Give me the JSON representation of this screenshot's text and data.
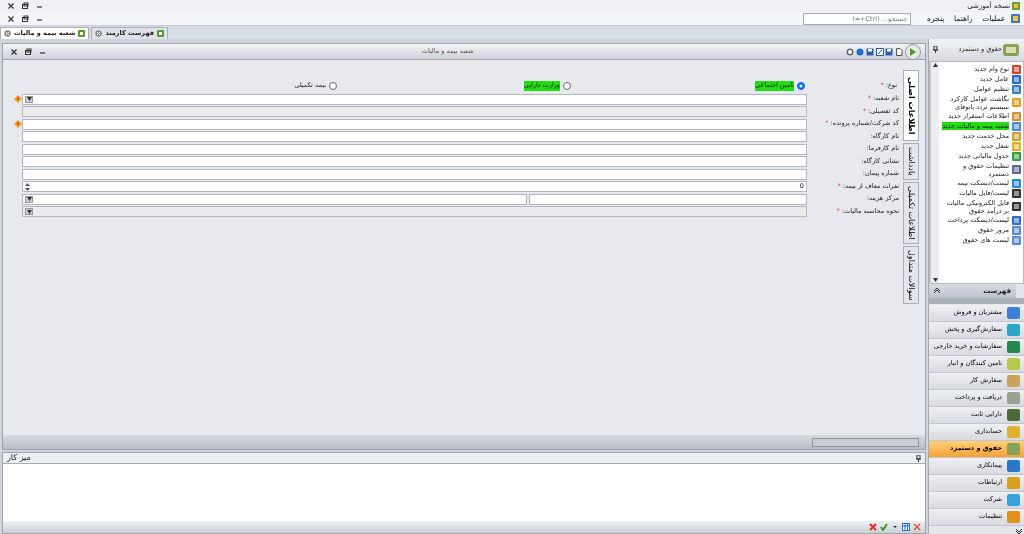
{
  "window": {
    "title": "نسخه آموزشی"
  },
  "menu": {
    "items": [
      "عملیات",
      "راهنما",
      "پنجره"
    ],
    "search": {
      "placeholder": "جستجو... (Ctrl+=)"
    }
  },
  "doc_tabs": [
    {
      "label": "فهرست کارمند",
      "selected": false
    },
    {
      "label": "شعبه بیمه و مالیات",
      "selected": true
    }
  ],
  "document": {
    "title": "شعبه بیمه و مالیات",
    "side_tabs": [
      {
        "label": "اطلاعات اصلی",
        "selected": true
      },
      {
        "label": "یادداشت",
        "selected": false
      },
      {
        "label": "اطلاعات تکمیلی",
        "selected": false
      },
      {
        "label": "سوالات متداول",
        "selected": false
      }
    ],
    "type": {
      "label": "نوع:",
      "mark": "*",
      "options": [
        {
          "label": "تامین اجتماعی",
          "selected": true,
          "highlighted": true
        },
        {
          "label": "وزارت دارایی",
          "selected": false,
          "highlighted": true
        },
        {
          "label": "بیمه تکمیلی",
          "selected": false,
          "highlighted": false
        }
      ]
    },
    "fields": [
      {
        "label": "نام شعبه:",
        "mark": "*",
        "kind": "combo",
        "warning": true
      },
      {
        "label": "کد تفصیلی:",
        "mark": "*",
        "kind": "text",
        "disabled": true
      },
      {
        "label": "کد شرکت/شماره پرونده:",
        "mark": "*",
        "kind": "text",
        "warning": true
      },
      {
        "label": "نام کارگاه:",
        "kind": "text"
      },
      {
        "label": "نام کارفرما:",
        "kind": "text"
      },
      {
        "label": "نشانی کارگاه:",
        "kind": "text"
      },
      {
        "label": "شماره پیمان:",
        "kind": "text"
      },
      {
        "label": "نفرات معاف از بیمه:",
        "mark": "*",
        "kind": "spin",
        "value": "0"
      },
      {
        "label": "مرکز هزینه:",
        "kind": "split"
      },
      {
        "label": "نحوه محاسبه مالیات:",
        "mark": "*",
        "kind": "combo",
        "disabled": true
      }
    ]
  },
  "sidebar": {
    "title": "حقوق و دستمزد",
    "items": [
      {
        "label": "نوع وام جدید",
        "highlighted": false
      },
      {
        "label": "عامل جدید",
        "highlighted": false
      },
      {
        "label": "تنظیم عوامل",
        "highlighted": false
      },
      {
        "label": "نگاشت عوامل کارکرد سیستم تردد باتوقای",
        "highlighted": false
      },
      {
        "label": "اطلاعات استقرار جدید",
        "highlighted": false
      },
      {
        "label": "شعبه بیمه و مالیات جدید",
        "highlighted": true
      },
      {
        "label": "محل خدمت جدید",
        "highlighted": false
      },
      {
        "label": "شغل جدید",
        "highlighted": false
      },
      {
        "label": "جدول مالیاتی جدید",
        "highlighted": false
      },
      {
        "label": "تنظیمات حقوق و دستمزد",
        "highlighted": false
      },
      {
        "label": "لیست/دیسکت بیمه",
        "highlighted": false
      },
      {
        "label": "لیست/فایل مالیات",
        "highlighted": false
      },
      {
        "label": "فایل الکترونیکی مالیات بر درآمد حقوق",
        "highlighted": false
      },
      {
        "label": "لیست/دیسکت پرداخت",
        "highlighted": false
      },
      {
        "label": "مرور حقوق",
        "highlighted": false
      },
      {
        "label": "لیست های حقوق",
        "highlighted": false
      }
    ],
    "section": "فهرست",
    "modules": [
      {
        "label": "مشتریان و فروش",
        "selected": false,
        "color": "#3d7fd6"
      },
      {
        "label": "سفارش‌گیری و پخش",
        "selected": false,
        "color": "#2aa6c9"
      },
      {
        "label": "سفارشات و خرید خارجی",
        "selected": false,
        "color": "#1f8a4c"
      },
      {
        "label": "تامین کنندگان و انبار",
        "selected": false,
        "color": "#b8c84a"
      },
      {
        "label": "سفارش کار",
        "selected": false,
        "color": "#c9a35a"
      },
      {
        "label": "دریافت و پرداخت",
        "selected": false,
        "color": "#9aa08f"
      },
      {
        "label": "دارایی ثابت",
        "selected": false,
        "color": "#4a6a3a"
      },
      {
        "label": "حسابداری",
        "selected": false,
        "color": "#e0b030"
      },
      {
        "label": "حقوق و دستمزد",
        "selected": true,
        "color": "#8aa05a"
      },
      {
        "label": "پیمانکاری",
        "selected": false,
        "color": "#2a78c8"
      },
      {
        "label": "ارتباطات",
        "selected": false,
        "color": "#d8a020"
      },
      {
        "label": "شرکت",
        "selected": false,
        "color": "#3aa0d8"
      },
      {
        "label": "تنظیمات",
        "selected": false,
        "color": "#e09018"
      }
    ]
  },
  "workspace": {
    "title": "میز کار"
  }
}
